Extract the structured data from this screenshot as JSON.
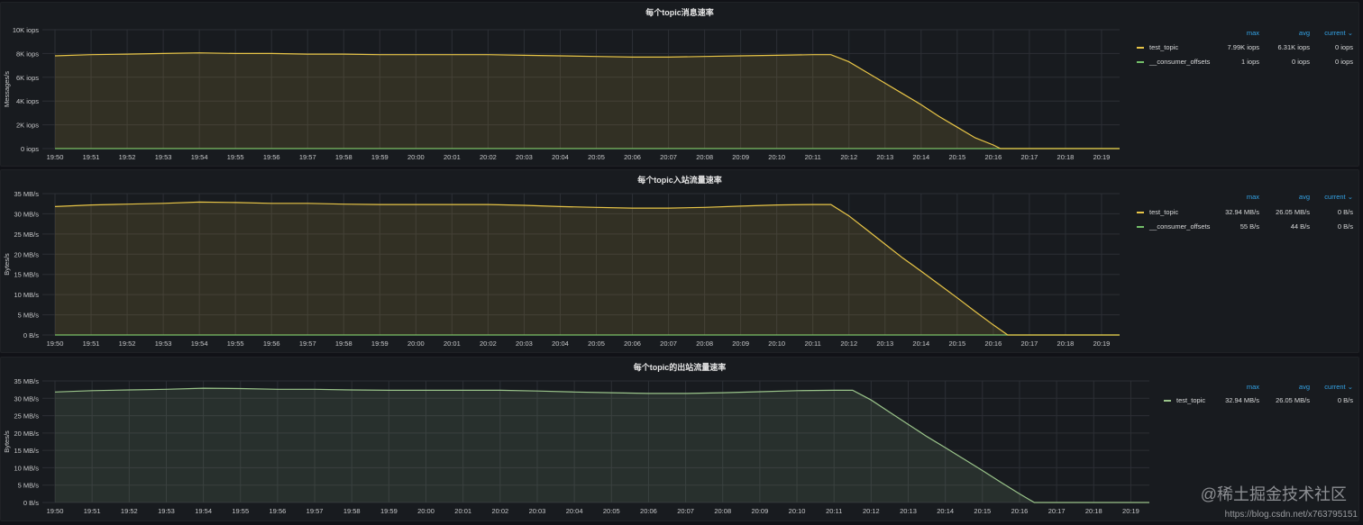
{
  "chart_data": [
    {
      "type": "area",
      "title": "每个topic消息速率",
      "ylabel": "Messages/s",
      "ylim": [
        0,
        10000
      ],
      "yticks": [
        "0 iops",
        "2K iops",
        "4K iops",
        "6K iops",
        "8K iops",
        "10K iops"
      ],
      "xticks": [
        "19:50",
        "19:51",
        "19:52",
        "19:53",
        "19:54",
        "19:55",
        "19:56",
        "19:57",
        "19:58",
        "19:59",
        "20:00",
        "20:01",
        "20:02",
        "20:03",
        "20:04",
        "20:05",
        "20:06",
        "20:07",
        "20:08",
        "20:09",
        "20:10",
        "20:11",
        "20:12",
        "20:13",
        "20:14",
        "20:15",
        "20:16",
        "20:17",
        "20:18",
        "20:19"
      ],
      "legend_headers": [
        "max",
        "avg",
        "current"
      ],
      "series": [
        {
          "name": "test_topic",
          "color": "#e8c547",
          "stats": [
            "7.99K iops",
            "6.31K iops",
            "0 iops"
          ],
          "x": [
            0,
            1,
            2,
            3,
            4,
            5,
            6,
            7,
            8,
            9,
            10,
            11,
            12,
            13,
            14,
            15,
            16,
            17,
            18,
            19,
            20,
            21,
            21.5,
            22,
            22.5,
            23,
            23.5,
            24,
            24.5,
            25,
            25.5,
            26,
            26.2,
            26.5,
            27,
            28,
            29,
            29.5
          ],
          "y": [
            7800,
            7900,
            7950,
            8000,
            8050,
            8000,
            8000,
            7950,
            7950,
            7900,
            7900,
            7900,
            7900,
            7850,
            7800,
            7750,
            7700,
            7700,
            7750,
            7800,
            7850,
            7900,
            7900,
            7300,
            6400,
            5500,
            4600,
            3700,
            2700,
            1800,
            900,
            300,
            0,
            0,
            0,
            0,
            0,
            0
          ]
        },
        {
          "name": "__consumer_offsets",
          "color": "#73bf69",
          "stats": [
            "1 iops",
            "0 iops",
            "0 iops"
          ],
          "x": [
            0,
            29.5
          ],
          "y": [
            0,
            0
          ]
        }
      ]
    },
    {
      "type": "area",
      "title": "每个topic入站流量速率",
      "ylabel": "Bytes/s",
      "ylim": [
        0,
        35
      ],
      "yticks": [
        "0 B/s",
        "5 MB/s",
        "10 MB/s",
        "15 MB/s",
        "20 MB/s",
        "25 MB/s",
        "30 MB/s",
        "35 MB/s"
      ],
      "xticks": [
        "19:50",
        "19:51",
        "19:52",
        "19:53",
        "19:54",
        "19:55",
        "19:56",
        "19:57",
        "19:58",
        "19:59",
        "20:00",
        "20:01",
        "20:02",
        "20:03",
        "20:04",
        "20:05",
        "20:06",
        "20:07",
        "20:08",
        "20:09",
        "20:10",
        "20:11",
        "20:12",
        "20:13",
        "20:14",
        "20:15",
        "20:16",
        "20:17",
        "20:18",
        "20:19"
      ],
      "legend_headers": [
        "max",
        "avg",
        "current"
      ],
      "series": [
        {
          "name": "test_topic",
          "color": "#e8c547",
          "stats": [
            "32.94 MB/s",
            "26.05 MB/s",
            "0 B/s"
          ],
          "x": [
            0,
            1,
            2,
            3,
            4,
            5,
            6,
            7,
            8,
            9,
            10,
            11,
            12,
            13,
            14,
            15,
            16,
            17,
            18,
            19,
            20,
            21,
            21.5,
            22,
            22.5,
            23,
            23.5,
            24,
            24.5,
            25,
            25.5,
            26,
            26.4,
            26.7,
            27,
            28,
            29,
            29.5
          ],
          "y": [
            31.8,
            32.2,
            32.4,
            32.6,
            32.9,
            32.8,
            32.6,
            32.6,
            32.4,
            32.3,
            32.3,
            32.3,
            32.3,
            32.1,
            31.8,
            31.6,
            31.4,
            31.4,
            31.6,
            31.9,
            32.2,
            32.3,
            32.3,
            29.5,
            26,
            22.5,
            19,
            15.8,
            12.5,
            9.2,
            5.8,
            2.5,
            0,
            0,
            0,
            0,
            0,
            0
          ]
        },
        {
          "name": "__consumer_offsets",
          "color": "#73bf69",
          "stats": [
            "55 B/s",
            "44 B/s",
            "0 B/s"
          ],
          "x": [
            0,
            29.5
          ],
          "y": [
            0,
            0
          ]
        }
      ]
    },
    {
      "type": "area",
      "title": "每个topic的出站流量速率",
      "ylabel": "Bytes/s",
      "ylim": [
        0,
        35
      ],
      "yticks": [
        "0 B/s",
        "5 MB/s",
        "10 MB/s",
        "15 MB/s",
        "20 MB/s",
        "25 MB/s",
        "30 MB/s",
        "35 MB/s"
      ],
      "xticks": [
        "19:50",
        "19:51",
        "19:52",
        "19:53",
        "19:54",
        "19:55",
        "19:56",
        "19:57",
        "19:58",
        "19:59",
        "20:00",
        "20:01",
        "20:02",
        "20:03",
        "20:04",
        "20:05",
        "20:06",
        "20:07",
        "20:08",
        "20:09",
        "20:10",
        "20:11",
        "20:12",
        "20:13",
        "20:14",
        "20:15",
        "20:16",
        "20:17",
        "20:18",
        "20:19"
      ],
      "legend_headers": [
        "max",
        "avg",
        "current"
      ],
      "series": [
        {
          "name": "test_topic",
          "color": "#9ac48a",
          "stats": [
            "32.94 MB/s",
            "26.05 MB/s",
            "0 B/s"
          ],
          "x": [
            0,
            1,
            2,
            3,
            4,
            5,
            6,
            7,
            8,
            9,
            10,
            11,
            12,
            13,
            14,
            15,
            16,
            17,
            18,
            19,
            20,
            21,
            21.5,
            22,
            22.5,
            23,
            23.5,
            24,
            24.5,
            25,
            25.5,
            26,
            26.4,
            26.7,
            27,
            28,
            29,
            29.5
          ],
          "y": [
            31.8,
            32.2,
            32.4,
            32.6,
            32.9,
            32.8,
            32.6,
            32.6,
            32.4,
            32.3,
            32.3,
            32.3,
            32.3,
            32.1,
            31.8,
            31.6,
            31.4,
            31.4,
            31.6,
            31.9,
            32.2,
            32.3,
            32.3,
            29.5,
            26,
            22.5,
            19,
            15.8,
            12.5,
            9.2,
            5.8,
            2.5,
            0,
            0,
            0,
            0,
            0,
            0
          ]
        }
      ]
    }
  ],
  "watermark": "@稀土掘金技术社区",
  "watermark_url": "https://blog.csdn.net/x763795151"
}
